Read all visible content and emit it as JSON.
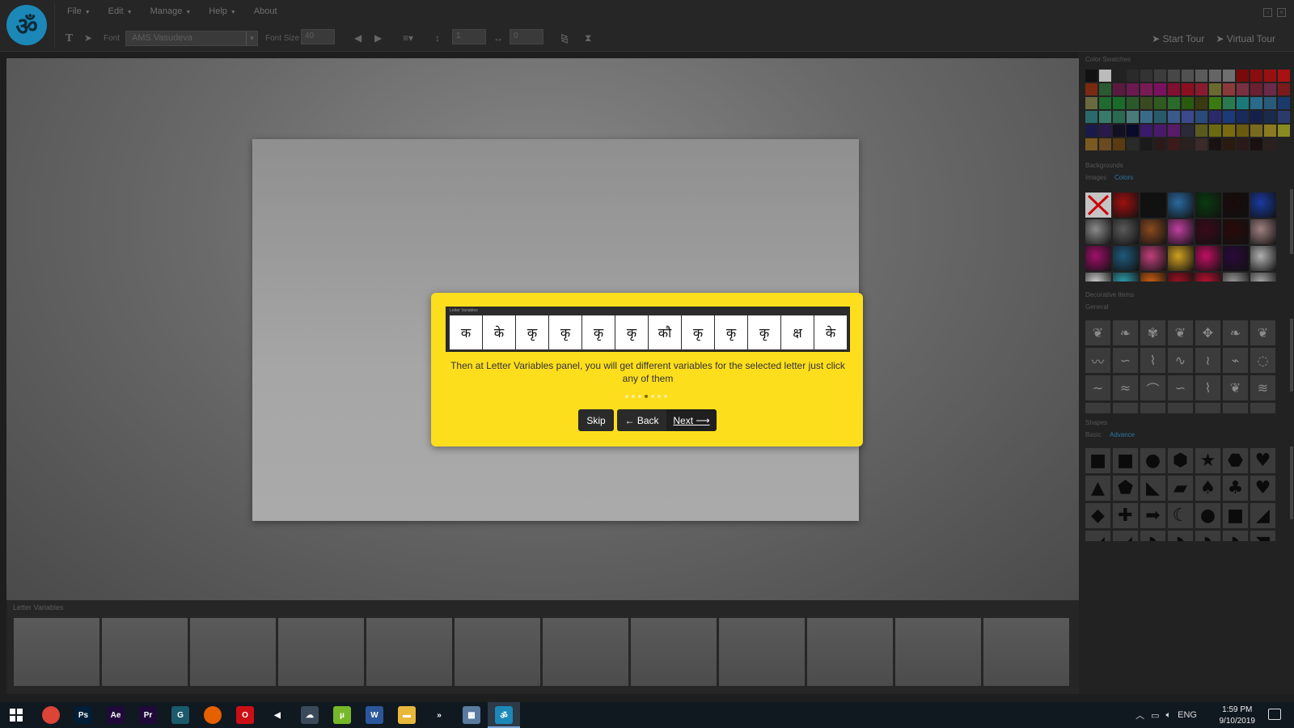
{
  "app": {
    "logo_glyph": "ॐ",
    "menu": [
      {
        "label": "File",
        "has_caret": true
      },
      {
        "label": "Edit",
        "has_caret": true
      },
      {
        "label": "Manage",
        "has_caret": true
      },
      {
        "label": "Help",
        "has_caret": true
      },
      {
        "label": "About",
        "has_caret": false
      }
    ]
  },
  "toolbar": {
    "font_label": "Font",
    "font_value": "AMS Vasudeva",
    "font_size_label": "Font Size",
    "font_size_value": "40",
    "line_spacing_value": "1",
    "letter_spacing_value": "0",
    "start_tour_label": "Start Tour",
    "virtual_tour_label": "Virtual Tour"
  },
  "tour": {
    "image_title": "Letter Variables",
    "letters": [
      "क",
      "के",
      "कृ",
      "कृ",
      "कृ",
      "कृ",
      "कौ",
      "कृ",
      "कृ",
      "कृ",
      "क्ष",
      "के"
    ],
    "text": "Then at Letter Variables panel, you will get different variables for the selected letter just click any of them",
    "dots_total": 7,
    "dots_active_index": 3,
    "skip_label": "Skip",
    "back_label": "← Back",
    "next_label": "Next ⟶"
  },
  "letter_variables": {
    "title": "Letter Variables",
    "cell_count": 12
  },
  "right_panel": {
    "color_swatches_title": "Color Swatches",
    "swatches": [
      "#111111",
      "#bbbbbb",
      "#222222",
      "#2a2a2a",
      "#333333",
      "#3d3d3d",
      "#474747",
      "#515151",
      "#5b5b5b",
      "#656565",
      "#6f6f6f",
      "#7a0a0a",
      "#8b0d0d",
      "#9a1010",
      "#a81212",
      "#7a2a10",
      "#2a5a30",
      "#5a1a40",
      "#6a1a50",
      "#7a1a55",
      "#7a1060",
      "#801030",
      "#8a1020",
      "#8a1a30",
      "#6a6a30",
      "#8a3a3a",
      "#7a3040",
      "#6a2030",
      "#6a2a4a",
      "#7a1a1a",
      "#6a6a40",
      "#206a30",
      "#1a6a2a",
      "#2a5a2a",
      "#3a4a20",
      "#305a20",
      "#2a6a2a",
      "#2a5a10",
      "#3a3a10",
      "#3a7a10",
      "#2a7a50",
      "#1a7a7a",
      "#2a6a8a",
      "#2a5a7a",
      "#1a3a6a",
      "#2a6a6a",
      "#3a7a6a",
      "#2a6a50",
      "#4a7a7a",
      "#3a6a8a",
      "#2a5a6a",
      "#3a5a8a",
      "#3a4a8a",
      "#2a4a7a",
      "#2a2a6a",
      "#1a3a7a",
      "#1a2a5a",
      "#15204a",
      "#1a2a4a",
      "#2a3a6a",
      "#1a1a4a",
      "#2a1a4a",
      "#111122",
      "#0a0a2a",
      "#3a1a6a",
      "#4a1a6a",
      "#5a1a6a",
      "#2a2a3a",
      "#5a5a20",
      "#6a6a10",
      "#7a6a10",
      "#6a5a10",
      "#7a6a20",
      "#8a7a20",
      "#8a8a20",
      "#7a5a20",
      "#6a4a20",
      "#5a3a10",
      "#2a2a2a",
      "#1a1a1a",
      "#2a1a1a",
      "#3a1a1a",
      "#2a2020",
      "#3a2a2a",
      "#1a1212",
      "#2a1a10",
      "#2a1a1a",
      "#1a1010",
      "#2a2020",
      "#222222"
    ],
    "backgrounds_title": "Backgrounds",
    "backgrounds_tabs": [
      "Images",
      "Colors"
    ],
    "backgrounds_active_tab": 1,
    "backgrounds": [
      "#c4c4c4",
      "#a01010",
      "#111111",
      "#2a6aa0",
      "#0a3a10",
      "#1a0a0a",
      "#1a3aa0",
      "#8a8a8a",
      "#5a5a5a",
      "#8a4a20",
      "#c040a0",
      "#3a0a1a",
      "#2a0a0a",
      "#a08080",
      "#a0106a",
      "#205a7a",
      "#c0407a",
      "#d0a020",
      "#c01060",
      "#2a0a3a",
      "#b0b0b0",
      "#d0d0d0",
      "#30a0b0",
      "#d06010",
      "#a01020",
      "#c01030",
      "#9a9a9a",
      "#aaaaaa"
    ],
    "decorative_title": "Decorative Items",
    "decorative_tab": "General",
    "decorative_items": [
      "❦",
      "❧",
      "✾",
      "❦",
      "✥",
      "❧",
      "❦",
      "〰",
      "∽",
      "⌇",
      "∿",
      "≀",
      "⌁",
      "◌",
      "∼",
      "≈",
      "⌒",
      "∽",
      "⌇",
      "❦",
      "≋",
      "⌓",
      "⌓",
      "⌓",
      "⌓",
      "⌓",
      "⌓",
      "⌓"
    ],
    "shapes_title": "Shapes",
    "shapes_tabs": [
      "Basic",
      "Advance"
    ],
    "shapes_active_tab": 1,
    "shapes": [
      "■",
      "■",
      "●",
      "⬢",
      "★",
      "⬣",
      "♥",
      "▲",
      "⬟",
      "◣",
      "▰",
      "♠",
      "♣",
      "♥",
      "◆",
      "✚",
      "➡",
      "☾",
      "●",
      "■",
      "◢",
      "◢",
      "◢",
      "◗",
      "◗",
      "◗",
      "◗",
      "◥"
    ]
  },
  "taskbar": {
    "apps": [
      {
        "name": "chrome",
        "label": "",
        "color": "#db4437"
      },
      {
        "name": "photoshop",
        "label": "Ps",
        "color": "#001e36"
      },
      {
        "name": "after-effects",
        "label": "Ae",
        "color": "#1f0a3a"
      },
      {
        "name": "premiere",
        "label": "Pr",
        "color": "#1f0a3a"
      },
      {
        "name": "app-g",
        "label": "G",
        "color": "#1a5a6a"
      },
      {
        "name": "firefox",
        "label": "",
        "color": "#e66000"
      },
      {
        "name": "opera",
        "label": "O",
        "color": "#cc0f16"
      },
      {
        "name": "app-red",
        "label": "◀",
        "color": "#101820"
      },
      {
        "name": "app-cloud",
        "label": "☁",
        "color": "#3a4a5a"
      },
      {
        "name": "utorrent",
        "label": "µ",
        "color": "#77b82a"
      },
      {
        "name": "word",
        "label": "W",
        "color": "#2b579a"
      },
      {
        "name": "file-explorer",
        "label": "▬",
        "color": "#e8b83a"
      },
      {
        "name": "app-green",
        "label": "»",
        "color": "#101820"
      },
      {
        "name": "app-image",
        "label": "▦",
        "color": "#5a7aa0"
      },
      {
        "name": "app-current",
        "label": "ॐ",
        "color": "#1c88b8"
      }
    ],
    "language": "ENG",
    "time": "1:59 PM",
    "date": "9/10/2019"
  }
}
